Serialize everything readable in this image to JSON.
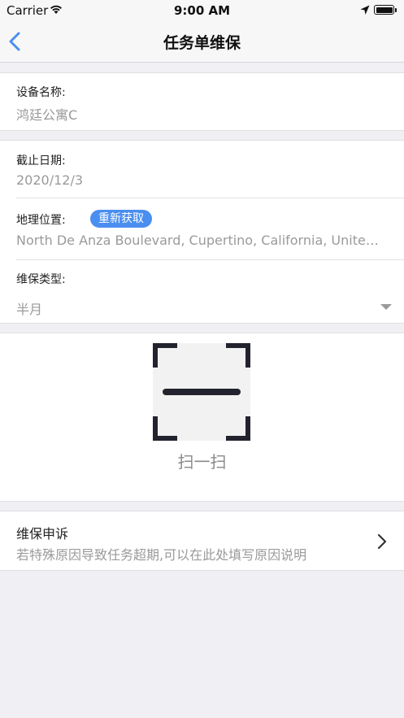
{
  "status_bar": {
    "carrier": "Carrier",
    "time": "9:00 AM"
  },
  "nav": {
    "title": "任务单维保",
    "back_icon": "chevron-left-icon"
  },
  "device": {
    "label": "设备名称:",
    "value": "鸿廷公寓C"
  },
  "deadline": {
    "label": "截止日期:",
    "value": "2020/12/3"
  },
  "location": {
    "label": "地理位置:",
    "refresh_button": "重新获取",
    "value": "North De Anza Boulevard, Cupertino, California, United States"
  },
  "maintenance_type": {
    "label": "维保类型:",
    "value": "半月"
  },
  "scan": {
    "label": "扫一扫",
    "icon": "qr-scan-icon"
  },
  "appeal": {
    "title": "维保申诉",
    "subtitle": "若特殊原因导致任务超期,可以在此处填写原因说明"
  },
  "colors": {
    "accent": "#4a8ef0",
    "background": "#efeff4",
    "nav_back": "#4a8ef0"
  }
}
